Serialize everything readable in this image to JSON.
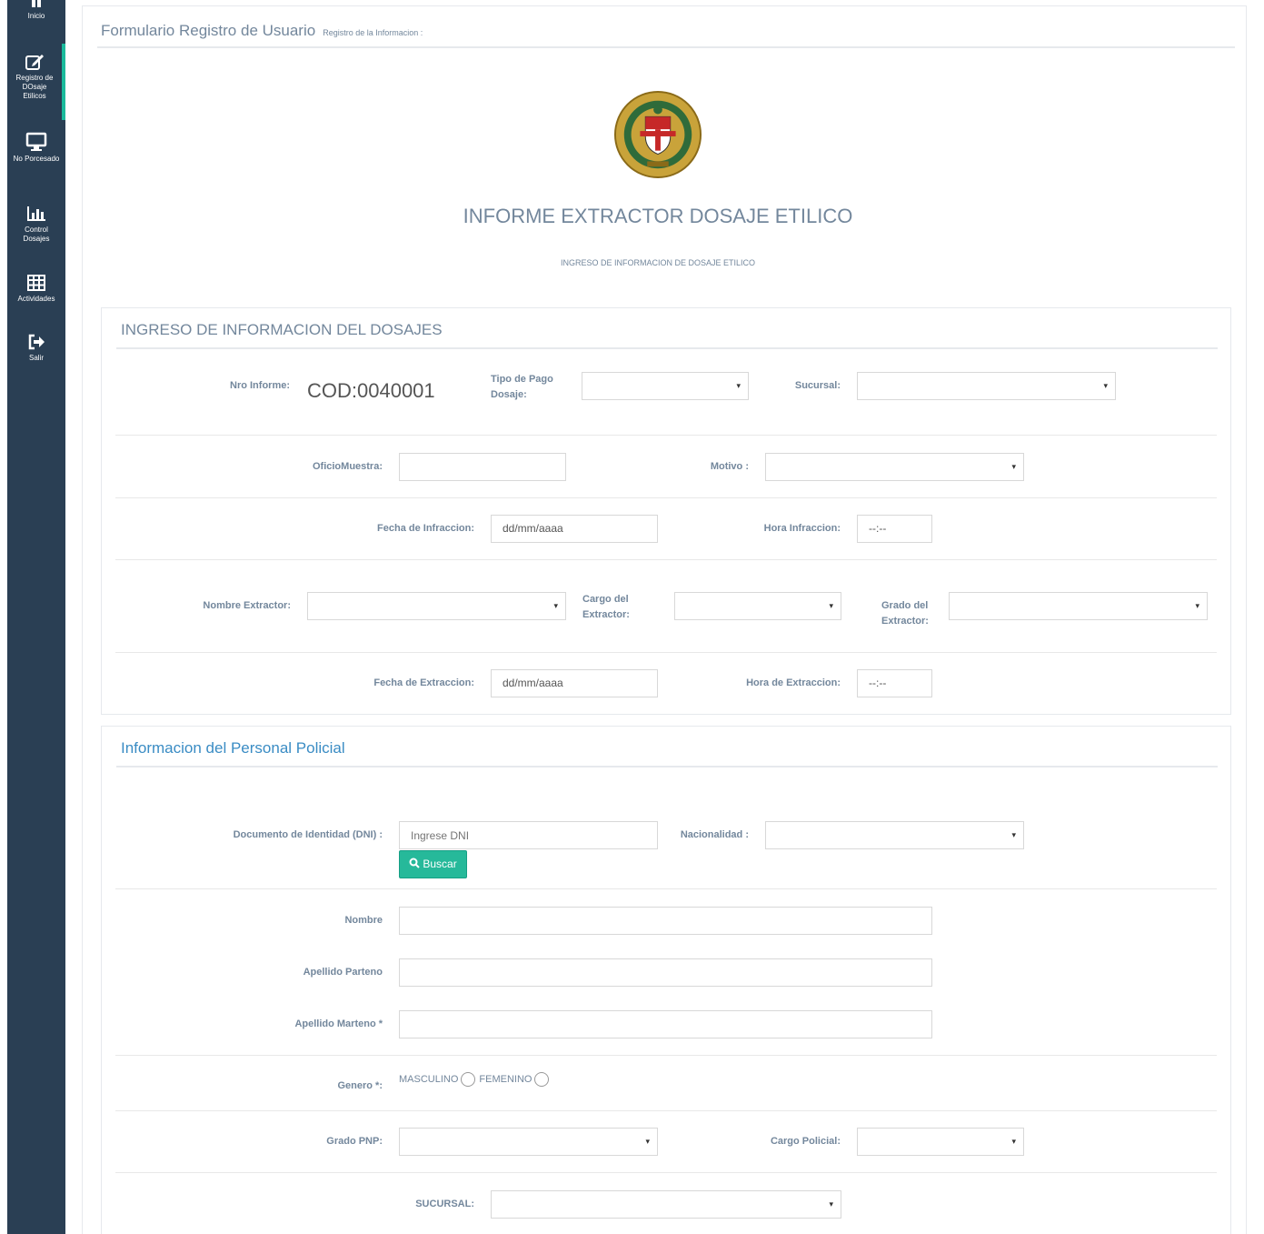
{
  "sidebar": {
    "items": [
      {
        "label": "Inicio",
        "icon": "home-icon"
      },
      {
        "label": "Registro de DOsaje Etilicos",
        "icon": "edit-icon"
      },
      {
        "label": "No Porcesado",
        "icon": "monitor-icon"
      },
      {
        "label": "Control Dosajes",
        "icon": "bar-chart-icon"
      },
      {
        "label": "Actividades",
        "icon": "table-icon"
      },
      {
        "label": "Salir",
        "icon": "sign-out-icon"
      }
    ]
  },
  "header": {
    "title": "Formulario Registro de Usuario",
    "subtitle": "Registro de la Informacion :"
  },
  "report": {
    "title": "INFORME EXTRACTOR DOSAJE ETILICO",
    "subtitle": "INGRESO DE INFORMACION DE DOSAJE ETILICO"
  },
  "section1": {
    "title": "INGRESO DE INFORMACION DEL DOSAJES",
    "nro_informe_label": "Nro Informe:",
    "nro_informe_value": "COD:0040001",
    "tipo_pago_label": "Tipo de Pago Dosaje:",
    "tipo_pago_value": "",
    "sucursal_label": "Sucursal:",
    "sucursal_value": "",
    "oficio_label": "OficioMuestra:",
    "oficio_value": "",
    "motivo_label": "Motivo :",
    "motivo_value": "",
    "fecha_infraccion_label": "Fecha de Infraccion:",
    "fecha_infraccion_value": "dd/mm/aaaa",
    "hora_infraccion_label": "Hora Infraccion:",
    "hora_infraccion_value": "--:--",
    "nombre_extractor_label": "Nombre Extractor:",
    "nombre_extractor_value": "",
    "cargo_extractor_label": "Cargo del Extractor:",
    "cargo_extractor_value": "",
    "grado_extractor_label": "Grado del Extractor:",
    "grado_extractor_value": "",
    "fecha_extraccion_label": "Fecha de Extraccion:",
    "fecha_extraccion_value": "dd/mm/aaaa",
    "hora_extraccion_label": "Hora de Extraccion:",
    "hora_extraccion_value": "--:--"
  },
  "section2": {
    "title": "Informacion del Personal Policial",
    "dni_label": "Documento de Identidad (DNI) :",
    "dni_placeholder": "Ingrese DNI",
    "buscar_label": "Buscar",
    "nacionalidad_label": "Nacionalidad :",
    "nacionalidad_value": "",
    "nombre_label": "Nombre",
    "nombre_value": "",
    "ap_paterno_label": "Apellido Parteno",
    "ap_paterno_value": "",
    "ap_materno_label": "Apellido Marteno *",
    "ap_materno_value": "",
    "genero_label": "Genero *:",
    "masculino_label": "MASCULINO",
    "femenino_label": "FEMENINO",
    "grado_pnp_label": "Grado PNP:",
    "grado_pnp_value": "",
    "cargo_policial_label": "Cargo Policial:",
    "cargo_policial_value": "",
    "sucursal_label": "SUCURSAL:",
    "sucursal_value": ""
  },
  "colors": {
    "sidebar_bg": "#2a3f54",
    "accent": "#1abb9c",
    "button": "#26b99a",
    "section_title_blue": "#3a8cc4"
  }
}
